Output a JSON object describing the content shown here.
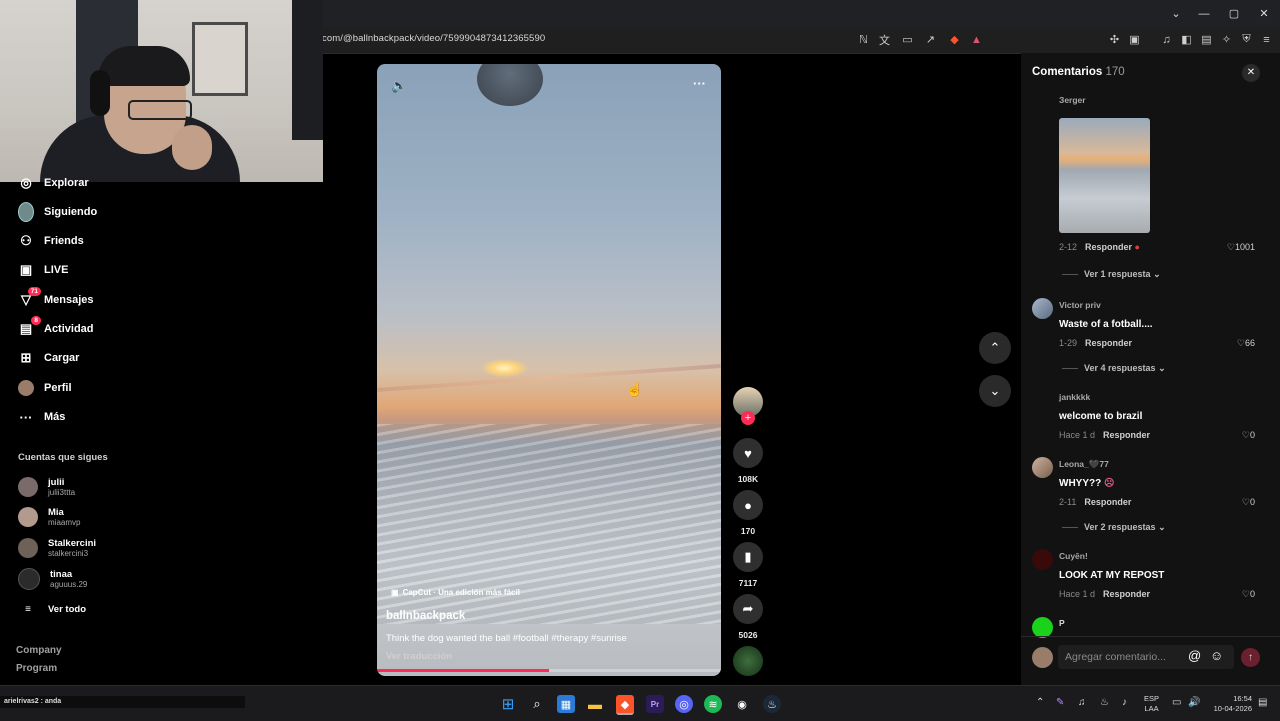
{
  "browser": {
    "url": "com/@ballnbackpack/video/7599904873412365590",
    "window_controls": [
      "⌄",
      "—",
      "▢",
      "✕"
    ]
  },
  "sidebar": {
    "items": [
      {
        "label": "Explorar",
        "icon": "compass-icon",
        "glyph": "◎"
      },
      {
        "label": "Siguiendo",
        "icon": "following-avatar-icon",
        "glyph": ""
      },
      {
        "label": "Friends",
        "icon": "friends-icon",
        "glyph": "👥"
      },
      {
        "label": "LIVE",
        "icon": "live-icon",
        "glyph": "▣"
      },
      {
        "label": "Mensajes",
        "icon": "messages-icon",
        "glyph": "▽",
        "badge": "71"
      },
      {
        "label": "Actividad",
        "icon": "activity-icon",
        "glyph": "▤",
        "badge": "8"
      },
      {
        "label": "Cargar",
        "icon": "upload-icon",
        "glyph": "⊞"
      },
      {
        "label": "Perfil",
        "icon": "profile-avatar-icon",
        "glyph": ""
      },
      {
        "label": "Más",
        "icon": "more-icon",
        "glyph": "···"
      }
    ],
    "following_header": "Cuentas que sigues",
    "following": [
      {
        "name": "julii",
        "handle": "julii3ttta",
        "color": "#7a6a6a"
      },
      {
        "name": "Mia",
        "handle": "miaamvp",
        "color": "#b29a8c"
      },
      {
        "name": "Stalkercini",
        "handle": "stalkercini3",
        "color": "#6e6258"
      },
      {
        "name": "tinaa",
        "handle": "aguuus.29",
        "color": "#2b2b2b"
      }
    ],
    "see_all": "Ver todo",
    "footer": [
      "Company",
      "Program"
    ]
  },
  "video": {
    "author": "ballnbackpack",
    "caption": "Think the dog wanted the ball #football #therapy #sunrise",
    "translate": "Ver traducción",
    "capcut": "CapCut · Una edición más fácil",
    "progress": 0.5
  },
  "actions": {
    "likes": "108K",
    "comments": "170",
    "saves": "7117",
    "shares": "5026"
  },
  "comments_panel": {
    "title": "Comentarios",
    "count": "170",
    "input_placeholder": "Agregar comentario...",
    "comments": [
      {
        "user": "Зerger",
        "text": "",
        "date": "2-12",
        "reply": "Responder",
        "likes": "1001",
        "replies": "Ver 1 respuesta",
        "avatar": "#000000"
      },
      {
        "user": "Victor priv",
        "text": "Waste of a fotball....",
        "date": "1-29",
        "reply": "Responder",
        "likes": "66",
        "replies": "Ver 4 respuestas",
        "avatar": "#8aa0c0"
      },
      {
        "user": "jankkkk",
        "text": "welcome to brazil",
        "date": "Hace 1 d",
        "reply": "Responder",
        "likes": "0",
        "replies": "",
        "avatar": "#000000"
      },
      {
        "user": "Leona_🖤77",
        "text": "WHYY??",
        "date": "2-11",
        "reply": "Responder",
        "likes": "0",
        "replies": "Ver 2 respuestas",
        "avatar": "#a88c78"
      },
      {
        "user": "Cuyēn!",
        "text": "LOOK AT MY REPOST",
        "date": "Hace 1 d",
        "reply": "Responder",
        "likes": "0",
        "replies": "",
        "avatar": "#3a0a0a"
      },
      {
        "user": "P",
        "text": "",
        "date": "",
        "reply": "",
        "likes": "",
        "replies": "",
        "avatar": "#19d219"
      }
    ]
  },
  "taskbar": {
    "status_left": "arielrivas2 : anda",
    "lang": "ESP",
    "lang2": "LAA",
    "time": "16:54",
    "date": "10-04-2026"
  }
}
